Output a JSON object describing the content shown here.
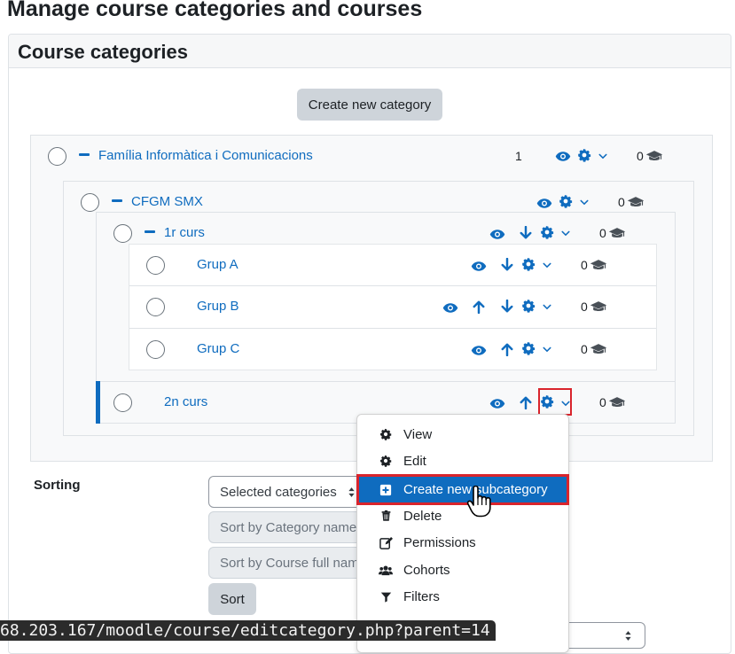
{
  "page": {
    "title": "Manage course categories and courses"
  },
  "card": {
    "title": "Course categories",
    "create_button": "Create new category"
  },
  "categories": [
    {
      "name": "Família Informàtica i Comunicacions",
      "course_count": "1",
      "subcat_count": "0"
    },
    {
      "name": "CFGM SMX",
      "subcat_count": "0"
    },
    {
      "name": "1r curs",
      "subcat_count": "0"
    },
    {
      "name": "Grup A",
      "subcat_count": "0"
    },
    {
      "name": "Grup B",
      "subcat_count": "0"
    },
    {
      "name": "Grup C",
      "subcat_count": "0"
    },
    {
      "name": "2n curs",
      "subcat_count": "0"
    }
  ],
  "menu": {
    "items": [
      {
        "label": "View",
        "icon": "gear-icon"
      },
      {
        "label": "Edit",
        "icon": "gear-icon"
      },
      {
        "label": "Create new subcategory",
        "icon": "plus-square-icon"
      },
      {
        "label": "Delete",
        "icon": "trash-icon"
      },
      {
        "label": "Permissions",
        "icon": "edit-icon"
      },
      {
        "label": "Cohorts",
        "icon": "users-icon"
      },
      {
        "label": "Filters",
        "icon": "filter-icon"
      }
    ]
  },
  "sorting": {
    "label": "Sorting",
    "select_selected": "Selected categories",
    "select_category": "Sort by Category name",
    "select_course": "Sort by Course full name",
    "sort_button": "Sort"
  },
  "statusbar": {
    "url": "68.203.167/moodle/course/editcategory.php?parent=14"
  },
  "colors": {
    "link": "#0f6cbf",
    "highlight": "#d9242c",
    "active_menu": "#0f6cbf"
  }
}
